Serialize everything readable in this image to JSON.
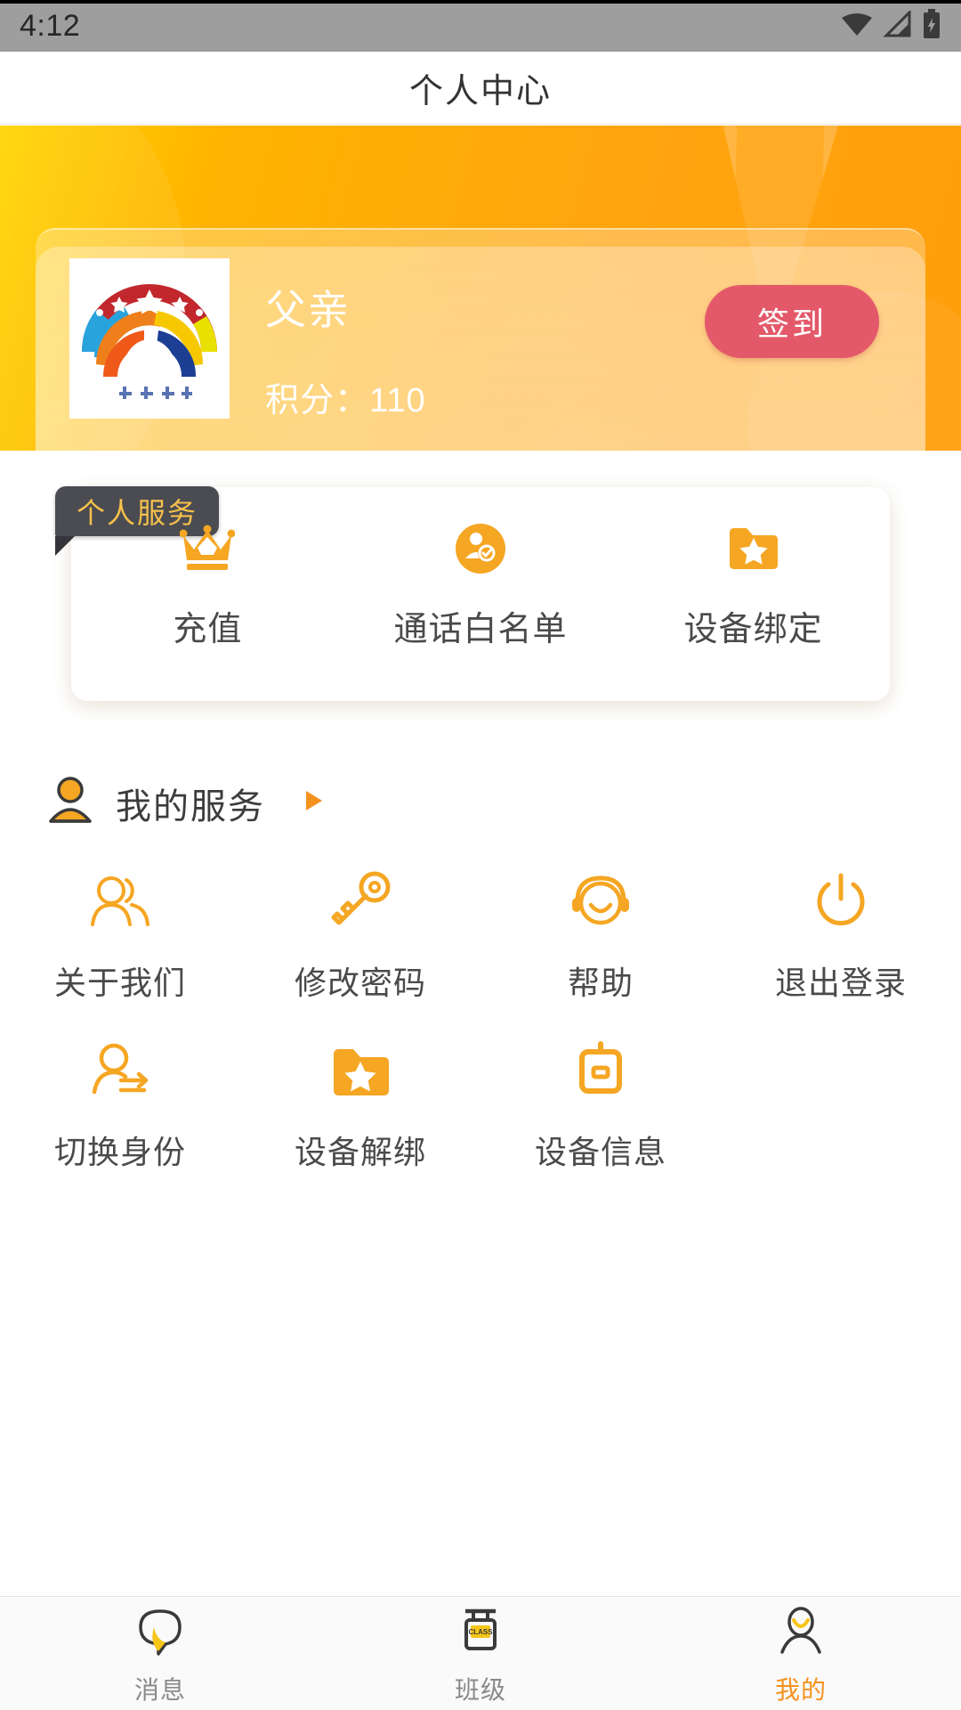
{
  "statusbar": {
    "time": "4:12",
    "icons": [
      "wifi-icon",
      "signal-icon",
      "battery-icon"
    ]
  },
  "header": {
    "title": "个人中心"
  },
  "profile": {
    "name": "父亲",
    "points_label": "积分：110",
    "signin_label": "签到",
    "avatar_name": "school-rainbow-logo"
  },
  "personal_service": {
    "tab_label": "个人服务",
    "items": [
      {
        "label": "充值",
        "icon": "crown-icon"
      },
      {
        "label": "通话白名单",
        "icon": "contact-circle-icon"
      },
      {
        "label": "设备绑定",
        "icon": "folder-star-icon"
      }
    ]
  },
  "my_service": {
    "title": "我的服务",
    "arrow": "play-triangle-icon",
    "header_icon": "person-icon",
    "items": [
      {
        "label": "关于我们",
        "icon": "two-people-icon"
      },
      {
        "label": "修改密码",
        "icon": "key-icon"
      },
      {
        "label": "帮助",
        "icon": "headset-smile-icon"
      },
      {
        "label": "退出登录",
        "icon": "power-icon"
      },
      {
        "label": "切换身份",
        "icon": "switch-user-icon"
      },
      {
        "label": "设备解绑",
        "icon": "folder-star-icon"
      },
      {
        "label": "设备信息",
        "icon": "device-info-icon"
      }
    ]
  },
  "bottom_nav": {
    "items": [
      {
        "label": "消息",
        "icon": "chat-bubble-icon",
        "active": false
      },
      {
        "label": "班级",
        "icon": "class-sign-icon",
        "active": false
      },
      {
        "label": "我的",
        "icon": "profile-person-icon",
        "active": true
      }
    ]
  },
  "colors": {
    "banner_start": "#ffd400",
    "banner_end": "#ff9e0a",
    "accent_orange": "#f5a623",
    "signin_red": "#e4596a",
    "tab_dark": "#4b4b52",
    "tab_text_gold": "#f6c14b",
    "nav_active": "#f5921e",
    "label_gray": "#4a4a4a"
  }
}
